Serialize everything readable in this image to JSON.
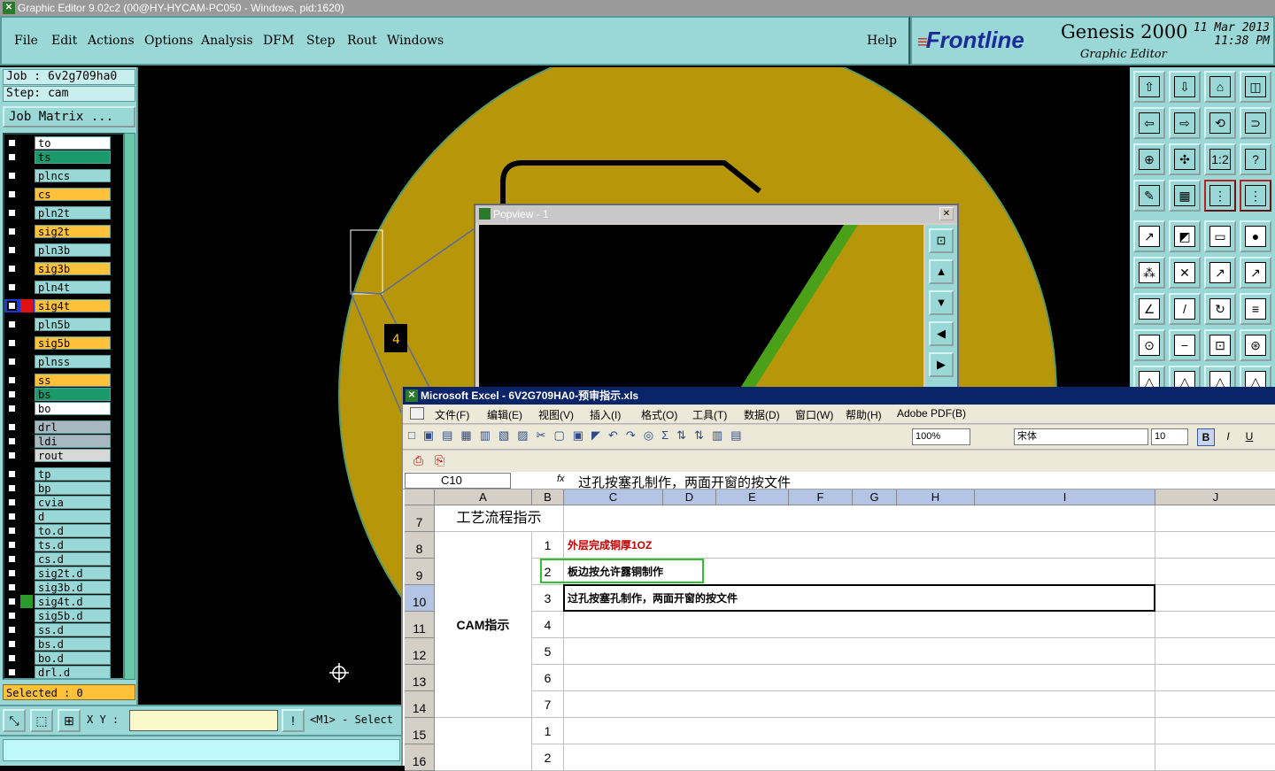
{
  "window": {
    "title": "Graphic Editor 9.02c2 (00@HY-HYCAM-PC050 - Windows, pid:1620)"
  },
  "menu": {
    "items": [
      "File",
      "Edit",
      "Actions",
      "Options",
      "Analysis",
      "DFM",
      "Step",
      "Rout",
      "Windows"
    ],
    "help": "Help"
  },
  "brand": {
    "logo": "Frontline",
    "product": "Genesis 2000",
    "subtitle": "Graphic Editor",
    "date": "11 Mar 2013",
    "time": "11:38 PM"
  },
  "job": {
    "job": "Job : 6v2g709ha0",
    "step": "Step: cam",
    "matrix": "Job Matrix ..."
  },
  "layers": [
    {
      "name": "to",
      "color": "#ffffff"
    },
    {
      "name": "ts",
      "color": "#1a9a6a"
    },
    {
      "name": "plncs",
      "color": "#9ad8d8"
    },
    {
      "name": "cs",
      "color": "#ffc03a"
    },
    {
      "name": "pln2t",
      "color": "#9ad8d8"
    },
    {
      "name": "sig2t",
      "color": "#ffc03a"
    },
    {
      "name": "pln3b",
      "color": "#9ad8d8"
    },
    {
      "name": "sig3b",
      "color": "#ffc03a"
    },
    {
      "name": "pln4t",
      "color": "#9ad8d8"
    },
    {
      "name": "sig4t",
      "color": "#ffc03a"
    },
    {
      "name": "pln5b",
      "color": "#9ad8d8"
    },
    {
      "name": "sig5b",
      "color": "#ffc03a"
    },
    {
      "name": "plnss",
      "color": "#9ad8d8"
    },
    {
      "name": "ss",
      "color": "#ffc03a"
    },
    {
      "name": "bs",
      "color": "#1a9a6a"
    },
    {
      "name": "bo",
      "color": "#ffffff"
    },
    {
      "name": "drl",
      "color": "#a8b8c0"
    },
    {
      "name": "ldi",
      "color": "#a8b8c0"
    },
    {
      "name": "rout",
      "color": "#d8d8d8"
    },
    {
      "name": "tp",
      "color": "#9ad8d8"
    },
    {
      "name": "bp",
      "color": "#9ad8d8"
    },
    {
      "name": "cvia",
      "color": "#9ad8d8"
    },
    {
      "name": "d",
      "color": "#9ad8d8"
    },
    {
      "name": "to.d",
      "color": "#9ad8d8"
    },
    {
      "name": "ts.d",
      "color": "#9ad8d8"
    },
    {
      "name": "cs.d",
      "color": "#9ad8d8"
    },
    {
      "name": "sig2t.d",
      "color": "#9ad8d8"
    },
    {
      "name": "sig3b.d",
      "color": "#9ad8d8"
    },
    {
      "name": "sig4t.d",
      "color": "#9ad8d8"
    },
    {
      "name": "sig5b.d",
      "color": "#9ad8d8"
    },
    {
      "name": "ss.d",
      "color": "#9ad8d8"
    },
    {
      "name": "bs.d",
      "color": "#9ad8d8"
    },
    {
      "name": "bo.d",
      "color": "#9ad8d8"
    },
    {
      "name": "drl.d",
      "color": "#9ad8d8"
    }
  ],
  "selected": "Selected : 0",
  "canvas": {
    "marker": "4"
  },
  "bottom": {
    "xy_label": "X Y :",
    "mouse_hint": "<M1> - Select"
  },
  "popview": {
    "title": "Popview - 1",
    "close": "✕"
  },
  "excel": {
    "title": "Microsoft Excel - 6V2G709HA0-预审指示.xls",
    "menu": [
      "文件(F)",
      "编辑(E)",
      "视图(V)",
      "插入(I)",
      "格式(O)",
      "工具(T)",
      "数据(D)",
      "窗口(W)",
      "帮助(H)",
      "Adobe PDF(B)"
    ],
    "zoom": "100%",
    "font": "宋体",
    "size": "10",
    "namebox": "C10",
    "fx": "fx",
    "formula": "过孔按塞孔制作，两面开窗的按文件",
    "columns": [
      "A",
      "B",
      "C",
      "D",
      "E",
      "F",
      "G",
      "H",
      "I",
      "J"
    ],
    "rows": [
      "7",
      "8",
      "9",
      "10",
      "11",
      "12",
      "13",
      "14",
      "15",
      "16"
    ],
    "a7": "工艺流程指示",
    "a_cam": "CAM指示",
    "items": [
      {
        "n": "1",
        "text": "外层完成铜厚1OZ",
        "color": "#c00000"
      },
      {
        "n": "2",
        "text": "板边按允许露铜制作",
        "color": "#000000"
      },
      {
        "n": "3",
        "text": "过孔按塞孔制作，两面开窗的按文件",
        "color": "#000000"
      },
      {
        "n": "4",
        "text": ""
      },
      {
        "n": "5",
        "text": ""
      },
      {
        "n": "6",
        "text": ""
      },
      {
        "n": "7",
        "text": ""
      },
      {
        "n": "1",
        "text": ""
      },
      {
        "n": "2",
        "text": ""
      }
    ]
  }
}
